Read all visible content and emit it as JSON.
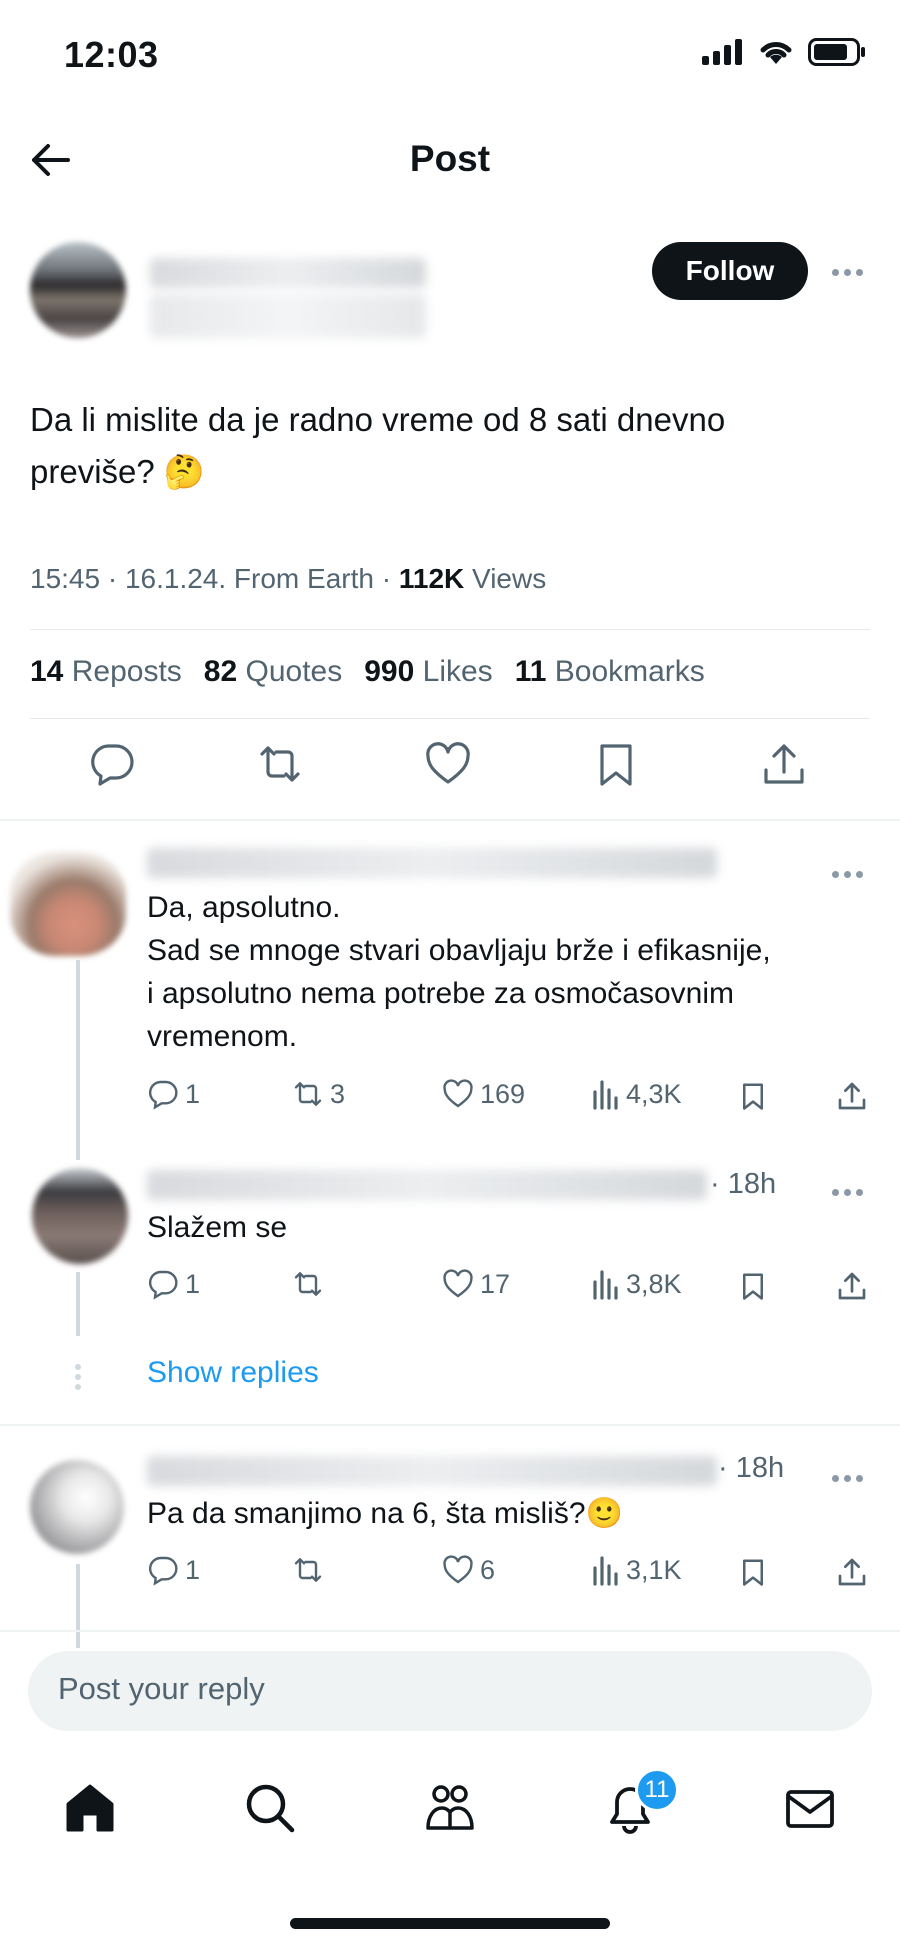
{
  "status_bar": {
    "time": "12:03",
    "icons": [
      "cellular-signal-icon",
      "wifi-icon",
      "battery-icon"
    ]
  },
  "nav": {
    "title": "Post",
    "back_icon": "back-arrow-icon"
  },
  "post": {
    "follow_label": "Follow",
    "text_line1": "Da li mislite da je radno vreme od 8 sati dnevno",
    "text_line2": "previše? 🤔",
    "meta_time": "15:45 · 16.1.24. From Earth · ",
    "meta_views_count": "112K",
    "meta_views_label": " Views",
    "stats": {
      "reposts_count": "14",
      "reposts_label": "Reposts",
      "quotes_count": "82",
      "quotes_label": "Quotes",
      "likes_count": "990",
      "likes_label": "Likes",
      "bookmarks_count": "11",
      "bookmarks_label": "Bookmarks"
    }
  },
  "replies": [
    {
      "time": "",
      "lines": [
        "Da, apsolutno.",
        "Sad se mnoge stvari obavljaju brže i efikasnije,",
        "i apsolutno nema potrebe za osmočasovnim",
        "vremenom."
      ],
      "replies": "1",
      "reposts": "3",
      "likes": "169",
      "views": "4,3K"
    },
    {
      "time": "· 18h",
      "lines": [
        "Slažem se"
      ],
      "replies": "1",
      "reposts": "",
      "likes": "17",
      "views": "3,8K"
    },
    {
      "time": "· 18h",
      "lines": [
        "Pa da smanjimo na 6, šta misliš?🙂"
      ],
      "replies": "1",
      "reposts": "",
      "likes": "6",
      "views": "3,1K"
    }
  ],
  "show_replies_label": "Show replies",
  "composer": {
    "placeholder": "Post your reply"
  },
  "tabbar": {
    "notifications_badge": "11"
  },
  "colors": {
    "accent": "#1d9bf0",
    "text": "#0f1419",
    "secondary": "#536471"
  }
}
